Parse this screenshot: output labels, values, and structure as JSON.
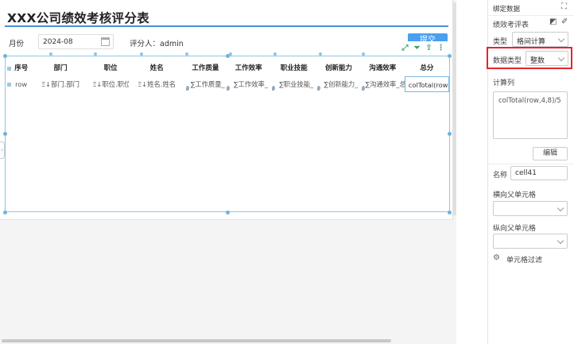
{
  "report": {
    "title": "XXX公司绩效考核评分表",
    "month_label": "月份",
    "month_value": "2024-08",
    "reviewer_label": "评分人：admin",
    "submit_label": "提交"
  },
  "table": {
    "headers": [
      "序号",
      "部门",
      "职位",
      "姓名",
      "工作质量",
      "工作效率",
      "职业技能",
      "创新能力",
      "沟通效率",
      "总分"
    ],
    "row": [
      "row",
      "Ξ↓部门.部门",
      "Ξ↓职位.职位",
      "Ξ↓姓名.姓名",
      "∑工作质量_",
      "∑工作效率_",
      "∑职业技能_",
      "∑创新能力_",
      "∑沟通效率_总",
      "colTotal(row,"
    ]
  },
  "toolbar_icons": [
    "expand-icon",
    "filter-icon",
    "export-icon",
    "more-icon"
  ],
  "panel": {
    "header": "绑定数据",
    "dataset": "绩效考评表",
    "type_label": "类型",
    "type_value": "格间计算",
    "data_type_label": "数据类型",
    "data_type_value": "整数",
    "calc_col_label": "计算列",
    "formula": "colTotal(row,4,8)/5",
    "edit_label": "编辑",
    "name_label": "名称",
    "name_value": "cell41",
    "h_parent_label": "横向父单元格",
    "v_parent_label": "纵向父单元格",
    "filter_label": "单元格过滤"
  },
  "colors": {
    "accent": "#4a90d9",
    "highlight": "#e0262f",
    "toolbar_green": "#3aa56b"
  }
}
